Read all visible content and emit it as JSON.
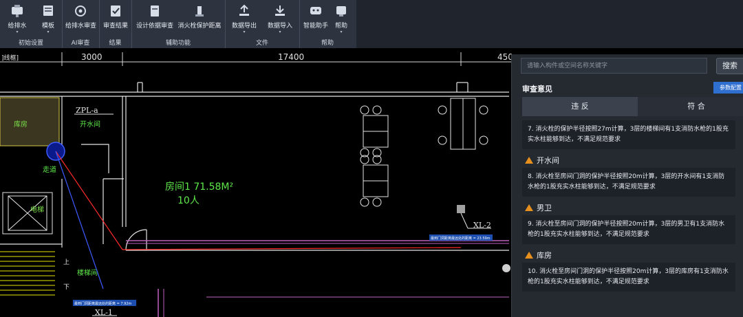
{
  "ribbon": {
    "groups": [
      {
        "label": "初始设置",
        "buttons": [
          {
            "label": "给排水",
            "dropdown": true,
            "icon": "pipe-icon"
          },
          {
            "label": "模板",
            "dropdown": true,
            "icon": "template-icon"
          }
        ]
      },
      {
        "label": "AI审查",
        "buttons": [
          {
            "label": "给排水审查",
            "dropdown": false,
            "icon": "ai-review-icon"
          }
        ]
      },
      {
        "label": "结果",
        "buttons": [
          {
            "label": "审查结果",
            "dropdown": false,
            "icon": "result-icon"
          }
        ]
      },
      {
        "label": "辅助功能",
        "buttons": [
          {
            "label": "设计依据审查",
            "dropdown": false,
            "icon": "design-basis-icon"
          },
          {
            "label": "消火栓保护距离",
            "dropdown": false,
            "icon": "hydrant-distance-icon"
          }
        ]
      },
      {
        "label": "文件",
        "buttons": [
          {
            "label": "数据导出",
            "dropdown": true,
            "icon": "export-icon"
          },
          {
            "label": "数据导入",
            "dropdown": true,
            "icon": "import-icon"
          }
        ]
      },
      {
        "label": "帮助",
        "buttons": [
          {
            "label": "智能助手",
            "dropdown": false,
            "icon": "assistant-icon"
          },
          {
            "label": "帮助",
            "dropdown": true,
            "icon": "help-icon"
          }
        ]
      }
    ]
  },
  "drawing": {
    "tab_label": "]线框]",
    "dims": [
      "3000",
      "17400",
      "450"
    ],
    "labels": {
      "zpl": "ZPL-a",
      "water_room": "开水间",
      "storage": "库房",
      "corridor": "走道",
      "elevator": "电梯",
      "room": "房间1 71.58M²",
      "people": "10人",
      "stairs": "楼梯间",
      "xl2": "XL-2",
      "xl1": "XL-1",
      "up": "上",
      "down": "下",
      "measure_right": "最到门洞距离最远处的距离 = 23.59m",
      "measure_left": "最到门洞距离最远处的距离 = 7.92m"
    }
  },
  "panel": {
    "search_placeholder": "请输入构件或空间名称关键字",
    "search_button": "搜索",
    "title": "审查意见",
    "param_button": "参数配置",
    "tabs": {
      "violation": "违 反",
      "compliant": "符 合"
    },
    "issues": [
      {
        "heading": "",
        "text": "7. 消火栓的保护半径按照27m计算，3层的楼梯间有1支消防水枪的1股充实水柱能够到达，不满足规范要求"
      },
      {
        "heading": "开水间",
        "text": "8. 消火栓至房间门洞的保护半径按照20m计算，3层的开水间有1支消防水枪的1股充实水柱能够到达，不满足规范要求"
      },
      {
        "heading": "男卫",
        "text": "9. 消火栓至房间门洞的保护半径按照20m计算，3层的男卫有1支消防水枪的1股充实水柱能够到达，不满足规范要求"
      },
      {
        "heading": "库房",
        "text": "10. 消火栓至房间门洞的保护半径按照20m计算，3层的库房有1支消防水枪的1股充实水柱能够到达，不满足规范要求"
      }
    ]
  }
}
